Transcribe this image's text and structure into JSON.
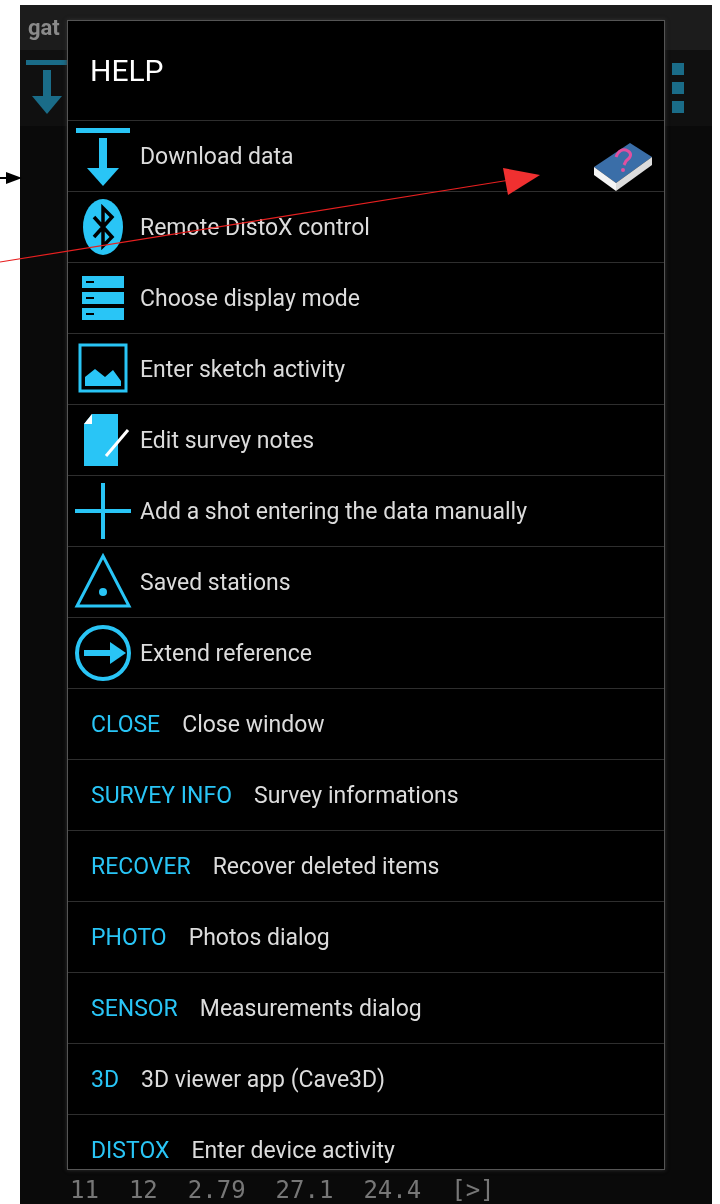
{
  "app": {
    "title": "gat"
  },
  "background_row": {
    "cells": [
      "11",
      "12",
      "2.79",
      "27.1",
      "24.4",
      "[>]"
    ]
  },
  "dialog": {
    "title": "HELP",
    "icon_items": [
      {
        "kind": "download",
        "label": "Download data"
      },
      {
        "kind": "bluetooth",
        "label": "Remote DistoX control"
      },
      {
        "kind": "display",
        "label": "Choose display mode"
      },
      {
        "kind": "sketch",
        "label": "Enter sketch activity"
      },
      {
        "kind": "notes",
        "label": "Edit survey notes"
      },
      {
        "kind": "add",
        "label": "Add a shot entering the data manually"
      },
      {
        "kind": "stations",
        "label": "Saved stations"
      },
      {
        "kind": "extend",
        "label": "Extend reference"
      }
    ],
    "text_items": [
      {
        "command": "CLOSE",
        "description": "Close window"
      },
      {
        "command": "SURVEY INFO",
        "description": "Survey informations"
      },
      {
        "command": "RECOVER",
        "description": "Recover deleted items"
      },
      {
        "command": "PHOTO",
        "description": "Photos dialog"
      },
      {
        "command": "SENSOR",
        "description": "Measurements dialog"
      },
      {
        "command": "3D",
        "description": "3D viewer app (Cave3D)"
      },
      {
        "command": "DISTOX",
        "description": "Enter device activity"
      }
    ]
  }
}
